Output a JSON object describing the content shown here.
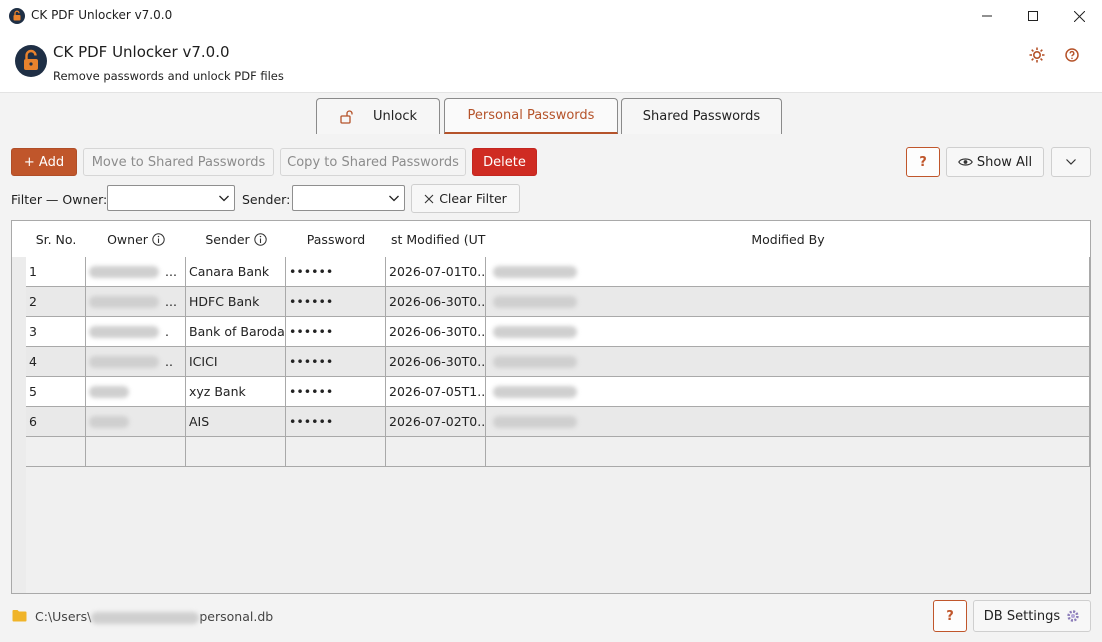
{
  "window": {
    "title": "CK PDF Unlocker  v7.0.0"
  },
  "header": {
    "app_title": "CK PDF Unlocker  v7.0.0",
    "subtitle": "Remove passwords and unlock PDF files"
  },
  "tabs": [
    {
      "label": "Unlock",
      "active": false,
      "icon": "lock-icon"
    },
    {
      "label": "Personal Passwords",
      "active": true
    },
    {
      "label": "Shared Passwords",
      "active": false
    }
  ],
  "toolbar": {
    "add_label": "+ Add",
    "move_label": "Move to Shared Passwords",
    "copy_label": "Copy to Shared Passwords",
    "delete_label": "Delete",
    "help_label": "?",
    "show_all_label": "Show All"
  },
  "filter": {
    "owner_label": "Filter — Owner:",
    "sender_label": "Sender:",
    "clear_label": "Clear Filter",
    "owner_value": "",
    "sender_value": ""
  },
  "table": {
    "columns": [
      "Sr. No.",
      "Owner",
      "Sender",
      "Password",
      "st Modified (UT",
      "Modified By"
    ],
    "rows": [
      {
        "sr": "1",
        "owner_suffix": "...",
        "sender": "Canara Bank",
        "password": "••••••",
        "modified": "2026-07-01T0..."
      },
      {
        "sr": "2",
        "owner_suffix": "...",
        "sender": "HDFC Bank",
        "password": "••••••",
        "modified": "2026-06-30T0..."
      },
      {
        "sr": "3",
        "owner_suffix": ".",
        "sender": "Bank of Baroda",
        "password": "••••••",
        "modified": "2026-06-30T0..."
      },
      {
        "sr": "4",
        "owner_suffix": "..",
        "sender": "ICICI",
        "password": "••••••",
        "modified": "2026-06-30T0..."
      },
      {
        "sr": "5",
        "owner_suffix": "",
        "sender": "xyz Bank",
        "password": "••••••",
        "modified": "2026-07-05T1..."
      },
      {
        "sr": "6",
        "owner_suffix": "",
        "sender": "AIS",
        "password": "••••••",
        "modified": "2026-07-02T0..."
      }
    ]
  },
  "footer": {
    "path_prefix": "C:\\Users\\",
    "path_suffix": "personal.db",
    "help_label": "?",
    "db_settings_label": "DB Settings"
  },
  "colors": {
    "accent": "#c0562b",
    "delete": "#cf2b22"
  }
}
